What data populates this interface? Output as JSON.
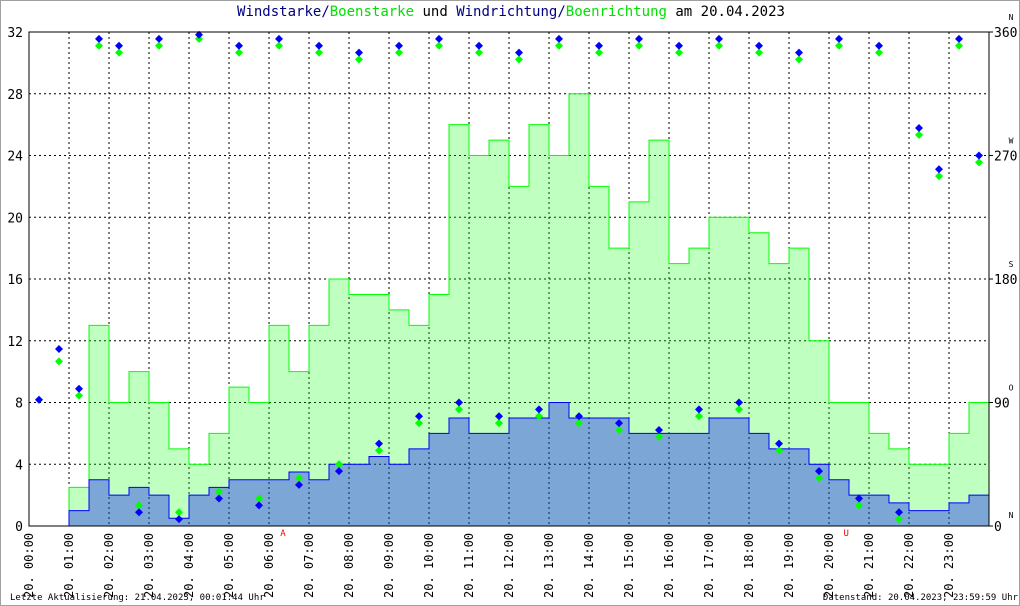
{
  "title": {
    "part1": "Windstarke",
    "sep1": "/",
    "part2": "Boenstarke",
    "mid": " und ",
    "part3": "Windrichtung",
    "sep2": "/",
    "part4": "Boenrichtung",
    "tail": " am 20.04.2023"
  },
  "footer": {
    "left": "Letzte Aktualisierung: 21.04.2023, 00:01:44 Uhr",
    "right": "Datenstand: 20.04.2023, 23:59:59 Uhr"
  },
  "colors": {
    "wind": "#0000ff",
    "gust": "#00ff00",
    "title_dark": "#000080",
    "sun": "#ff0000"
  },
  "chart_data": {
    "type": "line",
    "title": "Windstarke/Boenstarke und Windrichtung/Boenrichtung am 20.04.2023",
    "x_tick_labels": [
      "20. 00:00",
      "20. 01:00",
      "20. 02:00",
      "20. 03:00",
      "20. 04:00",
      "20. 05:00",
      "20. 06:00",
      "20. 07:00",
      "20. 08:00",
      "20. 09:00",
      "20. 10:00",
      "20. 11:00",
      "20. 12:00",
      "20. 13:00",
      "20. 14:00",
      "20. 15:00",
      "20. 16:00",
      "20. 17:00",
      "20. 18:00",
      "20. 19:00",
      "20. 20:00",
      "20. 21:00",
      "20. 22:00",
      "20. 23:00"
    ],
    "xlim_hours": [
      0,
      24
    ],
    "y_left": {
      "ylim": [
        0,
        32
      ],
      "ticks": [
        "0",
        "4",
        "8",
        "12",
        "16",
        "20",
        "24",
        "28",
        "32"
      ]
    },
    "y_right": {
      "ylim": [
        0,
        360
      ],
      "ticks": [
        "0",
        "90",
        "180",
        "270",
        "360"
      ],
      "compass": [
        "N",
        "O",
        "S",
        "W",
        "N"
      ]
    },
    "grid": true,
    "annotations": [
      {
        "label": "A",
        "hour": 6.35
      },
      {
        "label": "U",
        "hour": 20.43
      }
    ],
    "x_hours_step": 0.5,
    "series": [
      {
        "name": "Windstarke",
        "color": "#0000ff",
        "values": [
          0,
          0,
          1,
          3,
          2,
          2.5,
          2,
          0.5,
          2,
          2.5,
          3,
          3,
          3,
          3.5,
          3,
          4,
          4,
          4.5,
          4,
          5,
          6,
          7,
          6,
          6,
          7,
          7,
          8,
          7,
          7,
          7,
          6,
          6,
          6,
          6,
          7,
          7,
          6,
          5,
          5,
          4,
          3,
          2,
          2,
          1.5,
          1,
          1,
          1.5,
          2
        ]
      },
      {
        "name": "Boenstarke",
        "color": "#00ff00",
        "values": [
          0,
          0,
          2.5,
          13,
          8,
          10,
          8,
          5,
          4,
          6,
          9,
          8,
          13,
          10,
          13,
          16,
          15,
          15,
          14,
          13,
          15,
          26,
          24,
          25,
          22,
          26,
          24,
          28,
          22,
          18,
          21,
          25,
          17,
          18,
          20,
          20,
          19,
          17,
          18,
          12,
          8,
          8,
          6,
          5,
          4,
          4,
          6,
          8
        ]
      },
      {
        "name": "Windrichtung",
        "color": "#0000ff",
        "values": [
          92,
          129,
          100,
          355,
          350,
          10,
          355,
          5,
          358,
          20,
          350,
          15,
          355,
          30,
          350,
          40,
          345,
          60,
          350,
          80,
          355,
          90,
          350,
          80,
          345,
          85,
          355,
          80,
          350,
          75,
          355,
          70,
          350,
          85,
          355,
          90,
          350,
          60,
          345,
          40,
          355,
          20,
          350,
          10,
          290,
          260,
          355,
          270
        ]
      },
      {
        "name": "Boenrichtung",
        "color": "#00ff00",
        "values": [
          92,
          120,
          95,
          350,
          345,
          15,
          350,
          10,
          355,
          25,
          345,
          20,
          350,
          35,
          345,
          45,
          340,
          55,
          345,
          75,
          350,
          85,
          345,
          75,
          340,
          80,
          350,
          75,
          345,
          70,
          350,
          65,
          345,
          80,
          350,
          85,
          345,
          55,
          340,
          35,
          350,
          15,
          345,
          5,
          285,
          255,
          350,
          265
        ]
      }
    ]
  }
}
